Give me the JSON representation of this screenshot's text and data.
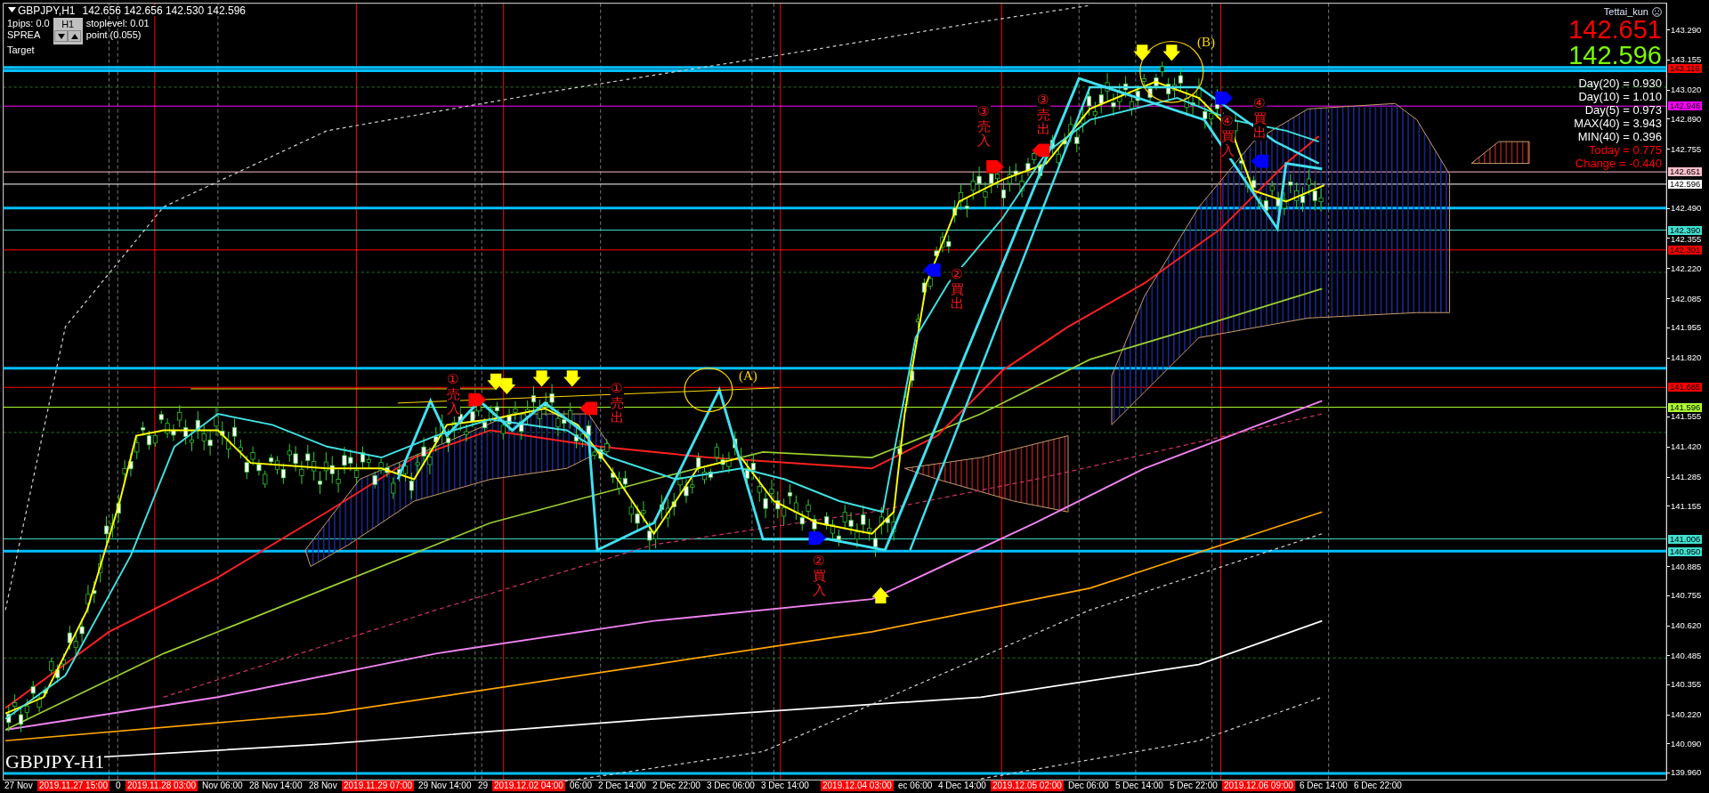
{
  "window": {
    "title": "GBPJPY,H1",
    "quote": "142.656 142.656 142.530 142.596"
  },
  "info_lines": [
    [
      "1pips: 0.0",
      "stoplevel: 0.01"
    ],
    [
      "SPREA",
      "point (0.055)"
    ],
    [
      "Target"
    ]
  ],
  "timeframe_widget": {
    "label": "H1"
  },
  "account": {
    "name": "Tettai_kun"
  },
  "prices": [
    {
      "text": "142.651",
      "color": "#ff0000"
    },
    {
      "text": "142.596",
      "color": "#7cfc00"
    }
  ],
  "stats": [
    {
      "text": "Day(20) = 0.930",
      "color": "#ffffff"
    },
    {
      "text": "Day(10) = 1.010",
      "color": "#ffffff"
    },
    {
      "text": "Day(5) = 0.973",
      "color": "#ffffff"
    },
    {
      "text": "MAX(40) = 3.943",
      "color": "#ffffff"
    },
    {
      "text": "MIN(40) = 0.396",
      "color": "#ffffff"
    },
    {
      "text": "Today = 0.775",
      "color": "#ff0000"
    },
    {
      "text": "Change = -0.440",
      "color": "#ff0000"
    }
  ],
  "annotations": [
    {
      "text": "①売入"
    },
    {
      "text": "①売出"
    },
    {
      "text": "②買入"
    },
    {
      "text": "②買出"
    },
    {
      "text": "③売入"
    },
    {
      "text": "③売出"
    },
    {
      "text": "④買入"
    },
    {
      "text": "④買出"
    }
  ],
  "wave_labels": [
    {
      "text": "(A)"
    },
    {
      "text": "(B)"
    }
  ],
  "price_axis": {
    "ticks": [
      "143.290",
      "143.155",
      "143.020",
      "142.890",
      "142.755",
      "142.490",
      "142.355",
      "142.220",
      "142.085",
      "141.955",
      "141.820",
      "141.555",
      "141.420",
      "141.285",
      "141.155",
      "140.885",
      "140.755",
      "140.620",
      "140.485",
      "140.355",
      "140.220",
      "140.090",
      "139.960"
    ],
    "labels": [
      {
        "text": "143.116",
        "color": "#ff0000"
      },
      {
        "text": "142.946",
        "color": "#ff00ff"
      },
      {
        "text": "142.651",
        "color": "#ffc0cb"
      },
      {
        "text": "142.596",
        "color": "#ffffff"
      },
      {
        "text": "142.390",
        "color": "#40e0d0"
      },
      {
        "text": "142.301",
        "color": "#ff0000"
      },
      {
        "text": "141.685",
        "color": "#ff0000"
      },
      {
        "text": "141.596",
        "color": "#adff2f"
      },
      {
        "text": "141.006",
        "color": "#40e0d0"
      },
      {
        "text": "140.950",
        "color": "#40e0d0"
      }
    ]
  },
  "time_axis": {
    "labels": [
      {
        "text": "27 Nov",
        "highlighted": false
      },
      {
        "text": "2019.11.27 15:00",
        "highlighted": true
      },
      {
        "text": "0",
        "highlighted": false
      },
      {
        "text": "2019.11.28 03:00",
        "highlighted": true
      },
      {
        "text": "Nov 06:00",
        "highlighted": false
      },
      {
        "text": "28 Nov 14:00",
        "highlighted": false
      },
      {
        "text": "28 Nov",
        "highlighted": false
      },
      {
        "text": "2019.11.29 07:00",
        "highlighted": true
      },
      {
        "text": "29 Nov 14:00",
        "highlighted": false
      },
      {
        "text": "29",
        "highlighted": false
      },
      {
        "text": "2019.12.02 04:00",
        "highlighted": true
      },
      {
        "text": "06:00",
        "highlighted": false
      },
      {
        "text": "2 Dec 14:00",
        "highlighted": false
      },
      {
        "text": "2 Dec 22:00",
        "highlighted": false
      },
      {
        "text": "3 Dec 06:00",
        "highlighted": false
      },
      {
        "text": "3 Dec 14:00",
        "highlighted": false
      },
      {
        "text": "2019.12.04 03:00",
        "highlighted": true
      },
      {
        "text": "ec 06:00",
        "highlighted": false
      },
      {
        "text": "4 Dec 14:00",
        "highlighted": false
      },
      {
        "text": "2019.12.05 02:00",
        "highlighted": true
      },
      {
        "text": "Dec 06:00",
        "highlighted": false
      },
      {
        "text": "5 Dec 14:00",
        "highlighted": false
      },
      {
        "text": "5 Dec 22:00",
        "highlighted": false
      },
      {
        "text": "2019.12.06 09:00",
        "highlighted": true
      },
      {
        "text": "6 Dec 14:00",
        "highlighted": false
      },
      {
        "text": "6 Dec 22:00",
        "highlighted": false
      }
    ]
  },
  "symbol_label": "GBPJPY-H1"
}
